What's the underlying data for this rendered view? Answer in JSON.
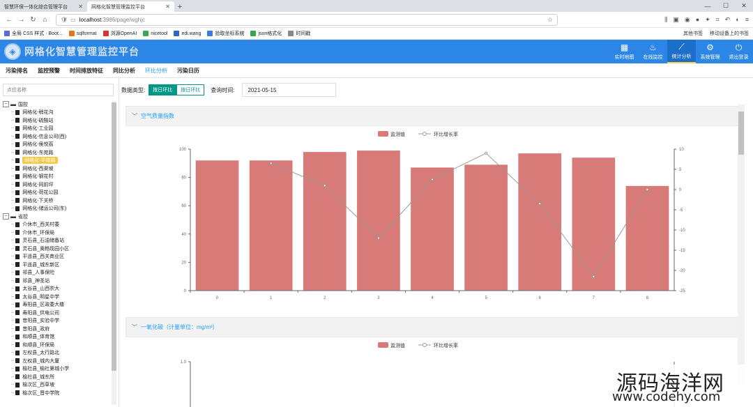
{
  "browser": {
    "tabs": [
      {
        "label": "智慧环保一体化综合管理平台",
        "active": false
      },
      {
        "label": "网格化智慧管理监控平台",
        "active": true
      }
    ],
    "url_host": "localhost",
    "url_path": ":3986/page/wghjc",
    "bookmarks": [
      {
        "label": "全局 CSS 样式 · Boot...",
        "icon": "bookmark-icon",
        "color": "#5b6bd6"
      },
      {
        "label": "sqlformat",
        "icon": "sqlformat-icon",
        "color": "#e07a20"
      },
      {
        "label": "浏源OpenAI",
        "icon": "openai-icon",
        "color": "#d23b2b"
      },
      {
        "label": "nicetool",
        "icon": "nicetool-icon",
        "color": "#3aa757"
      },
      {
        "label": "edi.wang",
        "icon": "edi-icon",
        "color": "#2b67c6"
      },
      {
        "label": "拾取坐标系统",
        "icon": "map-icon",
        "color": "#3c7be0"
      },
      {
        "label": "json格式化",
        "icon": "json-icon",
        "color": "#32a852"
      },
      {
        "label": "时间戳",
        "icon": "clock-icon",
        "color": "#888888"
      }
    ],
    "bookmarks_right": [
      "其他书签",
      "移动设备上的书签"
    ]
  },
  "header": {
    "title": "网格化智慧管理监控平台",
    "nav": [
      {
        "label": "实时地图",
        "icon": "map-icon",
        "active": false
      },
      {
        "label": "在线监控",
        "icon": "flame-icon",
        "active": false
      },
      {
        "label": "统计分析",
        "icon": "chart-icon",
        "active": true
      },
      {
        "label": "系统管理",
        "icon": "gears-icon",
        "active": false
      },
      {
        "label": "退出登录",
        "icon": "power-icon",
        "active": false
      }
    ]
  },
  "subnav": [
    {
      "label": "污染排名",
      "active": false
    },
    {
      "label": "监控预警",
      "active": false
    },
    {
      "label": "时间排放特征",
      "active": false
    },
    {
      "label": "同比分析",
      "active": false
    },
    {
      "label": "环比分析",
      "active": true
    },
    {
      "label": "污染日历",
      "active": false
    }
  ],
  "sidebar": {
    "search_placeholder": "点位名称",
    "groups": [
      {
        "label": "国控",
        "items": [
          "网格化-稍花沟",
          "网格化-硫酸站",
          "网格化-工业园",
          "网格化-信息公司(西)",
          "网格化-侯悦荔",
          "网格化-东苑路",
          "网格化-华南路",
          "网格化-西渠坡",
          "网格化-钢花村",
          "网格化-同前坪",
          "网格化-荷花公园",
          "网格化-下关桥",
          "网格化-储运公司(东)"
        ],
        "selected_index": 6
      },
      {
        "label": "省控",
        "items": [
          "介休市_西关村委",
          "介休市_环保局",
          "灵石县_石油储备站",
          "灵石县_奥畅现园小区",
          "平遥县_西关商业区",
          "平遥县_城东新区",
          "祁县_人事保险",
          "祁县_神圣站",
          "太谷县_山西农大",
          "太谷县_明星中学",
          "寿阳县_区政委大楼",
          "寿阳县_供电公司",
          "昔阳县_实验中学",
          "昔阳县_政府",
          "和顺县_体育馆",
          "和顺县_环保局",
          "左权县_太行路北",
          "左权县_城内大厦",
          "榆社县_榆社第城小学",
          "榆社县_城东所",
          "榆次区_西草坡",
          "榆次区_晋中学院"
        ]
      }
    ]
  },
  "filter": {
    "type_label": "数据类型:",
    "buttons": [
      {
        "label": "按日环比",
        "active": true
      },
      {
        "label": "按日环比",
        "active": false
      }
    ],
    "date_label": "查询时间:",
    "date_value": "2021-05-15"
  },
  "panels": [
    {
      "title": "空气质量指数"
    },
    {
      "title": "一氧化碳（计量单位：mg/m³）"
    }
  ],
  "colors": {
    "bar": "#d87a77",
    "line": "#999999",
    "accent": "#009688",
    "header": "#2c86e6",
    "link": "#1e9fff"
  },
  "chart_data": [
    {
      "type": "bar",
      "categories": [
        "0",
        "1",
        "2",
        "3",
        "4",
        "5",
        "6",
        "7",
        "8"
      ],
      "series": [
        {
          "name": "监测值",
          "kind": "bar",
          "axis": "left",
          "values": [
            92,
            92,
            98,
            99,
            87,
            89,
            97,
            94,
            74
          ]
        },
        {
          "name": "环比增长率",
          "kind": "line",
          "axis": "right",
          "values": [
            null,
            6.5,
            1,
            -12,
            2.5,
            9,
            -3.5,
            -21.5,
            0
          ]
        }
      ],
      "ylim": [
        0,
        100
      ],
      "yticks": [
        0,
        20,
        40,
        60,
        80,
        100
      ],
      "y2lim": [
        -25,
        10
      ],
      "y2ticks": [
        10,
        5,
        0,
        -5,
        -10,
        -15,
        -20,
        -25
      ],
      "legend": "top-center",
      "grid": false
    },
    {
      "type": "bar",
      "categories": [],
      "series": [
        {
          "name": "监测值",
          "kind": "bar"
        },
        {
          "name": "环比增长率",
          "kind": "line"
        }
      ],
      "yticks_visible": [
        1.0
      ],
      "legend": "top-center"
    }
  ],
  "watermark": {
    "line1": "源码海洋网",
    "line2": "www.codehy.com"
  }
}
